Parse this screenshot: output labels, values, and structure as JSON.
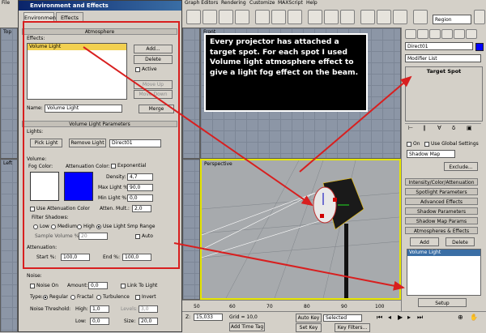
{
  "menubar": {
    "file": "File",
    "items": [
      "Graph Editors",
      "Rendering",
      "Customize",
      "MAXScript",
      "Help"
    ]
  },
  "toolbar": {
    "region": "Region"
  },
  "viewports": {
    "top": "Top",
    "front": "Front",
    "left": "Left",
    "perspective": "Perspective"
  },
  "dialog": {
    "title": "Environment and Effects",
    "tabs": [
      "Environment",
      "Effects"
    ],
    "atmosphere": {
      "header": "Atmosphere",
      "effects_label": "Effects:",
      "effects_list": [
        "Volume Light"
      ],
      "add": "Add...",
      "delete": "Delete",
      "active": "Active",
      "move_up": "Move Up",
      "move_down": "Move Down",
      "name_label": "Name:",
      "name_value": "Volume Light",
      "merge": "Merge"
    },
    "volume_params": {
      "header": "Volume Light Parameters",
      "lights_label": "Lights:",
      "pick_light": "Pick Light",
      "remove_light": "Remove Light",
      "light_select": "Direct01",
      "volume_label": "Volume:",
      "fog_color": "Fog Color:",
      "attenuation_color": "Attenuation Color:",
      "exponential": "Exponential",
      "density_label": "Density:",
      "density": "4,7",
      "max_label": "Max Light %:",
      "max": "90,0",
      "min_label": "Min Light %:",
      "min": "0,0",
      "atten_mult_label": "Atten. Mult.:",
      "atten_mult": "2,0",
      "use_atten_color": "Use Attenuation Color",
      "filter_shadows": "Filter Shadows:",
      "low": "Low",
      "medium": "Medium",
      "high": "High",
      "use_light_smp": "Use Light Smp Range",
      "sample_volume_label": "Sample Volume %:",
      "sample_volume": "20",
      "auto": "Auto",
      "attenuation_label": "Attenuation:",
      "start_label": "Start %:",
      "start": "100,0",
      "end_label": "End %:",
      "end": "100,0",
      "fog_color_hex": "#ffffff",
      "atten_color_hex": "#0000ff"
    },
    "noise": {
      "label": "Noise:",
      "noise_on": "Noise On",
      "amount_label": "Amount:",
      "amount": "0,0",
      "link_to_light": "Link To Light",
      "type_label": "Type:",
      "regular": "Regular",
      "fractal": "Fractal",
      "turbulence": "Turbulence",
      "invert": "Invert",
      "threshold_label": "Noise Threshold:",
      "high_label": "High:",
      "high": "1,0",
      "levels_label": "Levels:",
      "levels": "3,0",
      "low_label": "Low:",
      "low": "0,0",
      "size_label": "Size:",
      "size": "20,0"
    }
  },
  "callout": {
    "text": "Every projector has attached a target spot. For each spot I used Volume light atmosphere effect to give a light fog effect on the beam."
  },
  "command_panel": {
    "object_name": "Direct01",
    "modifier_list": "Modifier List",
    "stack_item": "Target Spot",
    "on": "On",
    "use_global": "Use Global Settings",
    "shadow_type": "Shadow Map",
    "exclude": "Exclude...",
    "rollouts": [
      "Intensity/Color/Attenuation",
      "Spotlight Parameters",
      "Advanced Effects",
      "Shadow Parameters",
      "Shadow Map Params",
      "Atmospheres & Effects"
    ],
    "add": "Add",
    "delete": "Delete",
    "effect_item": "Volume Light",
    "setup": "Setup"
  },
  "statusbar": {
    "timeline_ticks": [
      "50",
      "60",
      "70",
      "80",
      "90",
      "100"
    ],
    "coord": "15,033",
    "grid": "Grid = 10,0",
    "auto_key": "Auto Key",
    "selected": "Selected",
    "set_key": "Set Key",
    "key_filters": "Key Filters...",
    "add_time_tag": "Add Time Tag"
  }
}
